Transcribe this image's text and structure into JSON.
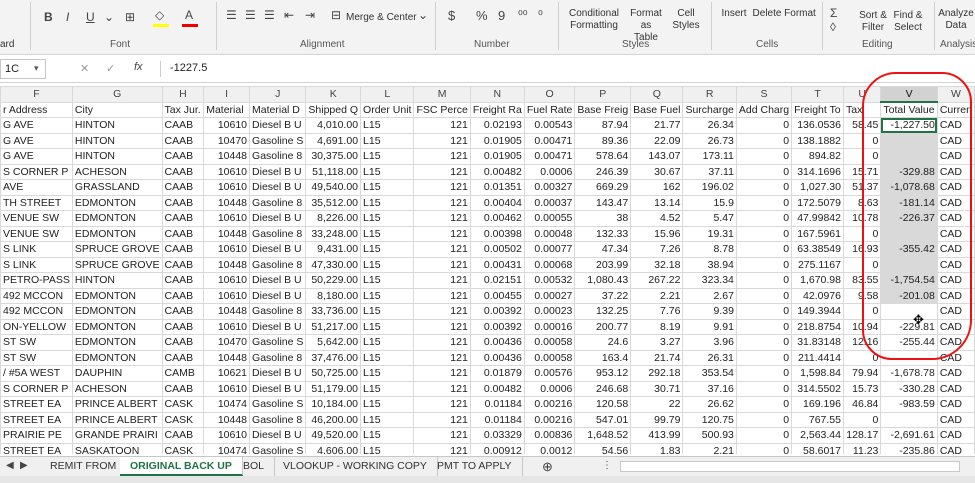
{
  "ribbon": {
    "groups": [
      "Font",
      "Alignment",
      "Number",
      "Styles",
      "Cells",
      "Editing",
      "Analysis"
    ],
    "clipboard_label": "ard",
    "merge_center": "Merge & Center",
    "cond_format": [
      "Conditional",
      "Formatting"
    ],
    "format_table": [
      "Format as",
      "Table"
    ],
    "cell_styles": [
      "Cell",
      "Styles"
    ],
    "insert": "Insert",
    "delete": "Delete",
    "format": "Format",
    "sort_filter": [
      "Sort &",
      "Filter"
    ],
    "find_select": [
      "Find &",
      "Select"
    ],
    "analyze": [
      "Analyze",
      "Data"
    ],
    "font_buttons": [
      "B",
      "I",
      "U"
    ],
    "number_buttons": [
      "$",
      "%",
      "9"
    ]
  },
  "formula_bar": {
    "name_box": "1C",
    "cancel": "✕",
    "enter": "✓",
    "fx": "fx",
    "value": "-1227.5"
  },
  "columns": [
    "F",
    "G",
    "H",
    "I",
    "J",
    "K",
    "L",
    "M",
    "N",
    "O",
    "P",
    "Q",
    "R",
    "S",
    "T",
    "U",
    "V",
    "W"
  ],
  "header_row": [
    "r Address",
    "City",
    "Tax Jur.",
    "Material",
    "Material D",
    "Shipped Q",
    "Order Unit",
    "FSC Perce",
    "Freight Ra",
    "Fuel Rate",
    "Base Freig",
    "Base Fuel",
    "Surcharge",
    "Add Charg",
    "Freight To",
    "Tax",
    "Total Value",
    "Curren"
  ],
  "rows": [
    [
      "G AVE",
      "HINTON",
      "CAAB",
      "10610",
      "Diesel B U",
      "4,010.00",
      "L15",
      "121",
      "0.02193",
      "0.00543",
      "87.94",
      "21.77",
      "26.34",
      "0",
      "136.0536",
      "58.45",
      "-1,227.50",
      "CAD"
    ],
    [
      "G AVE",
      "HINTON",
      "CAAB",
      "10470",
      "Gasoline S",
      "4,691.00",
      "L15",
      "121",
      "0.01905",
      "0.00471",
      "89.36",
      "22.09",
      "26.73",
      "0",
      "138.1882",
      "0",
      "",
      "CAD"
    ],
    [
      "G AVE",
      "HINTON",
      "CAAB",
      "10448",
      "Gasoline 8",
      "30,375.00",
      "L15",
      "121",
      "0.01905",
      "0.00471",
      "578.64",
      "143.07",
      "173.11",
      "0",
      "894.82",
      "0",
      "",
      "CAD"
    ],
    [
      "S CORNER P",
      "ACHESON",
      "CAAB",
      "10610",
      "Diesel B U",
      "51,118.00",
      "L15",
      "121",
      "0.00482",
      "0.0006",
      "246.39",
      "30.67",
      "37.11",
      "0",
      "314.1696",
      "15.71",
      "-329.88",
      "CAD"
    ],
    [
      "AVE",
      "GRASSLAND",
      "CAAB",
      "10610",
      "Diesel B U",
      "49,540.00",
      "L15",
      "121",
      "0.01351",
      "0.00327",
      "669.29",
      "162",
      "196.02",
      "0",
      "1,027.30",
      "51.37",
      "-1,078.68",
      "CAD"
    ],
    [
      "TH STREET",
      "EDMONTON",
      "CAAB",
      "10448",
      "Gasoline 8",
      "35,512.00",
      "L15",
      "121",
      "0.00404",
      "0.00037",
      "143.47",
      "13.14",
      "15.9",
      "0",
      "172.5079",
      "8.63",
      "-181.14",
      "CAD"
    ],
    [
      "VENUE SW",
      "EDMONTON",
      "CAAB",
      "10610",
      "Diesel B U",
      "8,226.00",
      "L15",
      "121",
      "0.00462",
      "0.00055",
      "38",
      "4.52",
      "5.47",
      "0",
      "47.99842",
      "10.78",
      "-226.37",
      "CAD"
    ],
    [
      "VENUE SW",
      "EDMONTON",
      "CAAB",
      "10448",
      "Gasoline 8",
      "33,248.00",
      "L15",
      "121",
      "0.00398",
      "0.00048",
      "132.33",
      "15.96",
      "19.31",
      "0",
      "167.5961",
      "0",
      "",
      "CAD"
    ],
    [
      "S LINK",
      "SPRUCE GROVE",
      "CAAB",
      "10610",
      "Diesel B U",
      "9,431.00",
      "L15",
      "121",
      "0.00502",
      "0.00077",
      "47.34",
      "7.26",
      "8.78",
      "0",
      "63.38549",
      "16.93",
      "-355.42",
      "CAD"
    ],
    [
      "S LINK",
      "SPRUCE GROVE",
      "CAAB",
      "10448",
      "Gasoline 8",
      "47,330.00",
      "L15",
      "121",
      "0.00431",
      "0.00068",
      "203.99",
      "32.18",
      "38.94",
      "0",
      "275.1167",
      "0",
      "",
      "CAD"
    ],
    [
      "PETRO-PASS",
      "HINTON",
      "CAAB",
      "10610",
      "Diesel B U",
      "50,229.00",
      "L15",
      "121",
      "0.02151",
      "0.00532",
      "1,080.43",
      "267.22",
      "323.34",
      "0",
      "1,670.98",
      "83.55",
      "-1,754.54",
      "CAD"
    ],
    [
      "492 MCCON",
      "EDMONTON",
      "CAAB",
      "10610",
      "Diesel B U",
      "8,180.00",
      "L15",
      "121",
      "0.00455",
      "0.00027",
      "37.22",
      "2.21",
      "2.67",
      "0",
      "42.0976",
      "9.58",
      "-201.08",
      "CAD"
    ],
    [
      "492 MCCON",
      "EDMONTON",
      "CAAB",
      "10448",
      "Gasoline 8",
      "33,736.00",
      "L15",
      "121",
      "0.00392",
      "0.00023",
      "132.25",
      "7.76",
      "9.39",
      "0",
      "149.3944",
      "0",
      "",
      "CAD"
    ],
    [
      "ON-YELLOW",
      "EDMONTON",
      "CAAB",
      "10610",
      "Diesel B U",
      "51,217.00",
      "L15",
      "121",
      "0.00392",
      "0.00016",
      "200.77",
      "8.19",
      "9.91",
      "0",
      "218.8754",
      "10.94",
      "-229.81",
      "CAD"
    ],
    [
      "ST SW",
      "EDMONTON",
      "CAAB",
      "10470",
      "Gasoline S",
      "5,642.00",
      "L15",
      "121",
      "0.00436",
      "0.00058",
      "24.6",
      "3.27",
      "3.96",
      "0",
      "31.83148",
      "12.16",
      "-255.44",
      "CAD"
    ],
    [
      "ST SW",
      "EDMONTON",
      "CAAB",
      "10448",
      "Gasoline 8",
      "37,476.00",
      "L15",
      "121",
      "0.00436",
      "0.00058",
      "163.4",
      "21.74",
      "26.31",
      "0",
      "211.4414",
      "0",
      "",
      "CAD"
    ],
    [
      "/ #5A WEST",
      "DAUPHIN",
      "CAMB",
      "10621",
      "Diesel B U",
      "50,725.00",
      "L15",
      "121",
      "0.01879",
      "0.00576",
      "953.12",
      "292.18",
      "353.54",
      "0",
      "1,598.84",
      "79.94",
      "-1,678.78",
      "CAD"
    ],
    [
      "S CORNER P",
      "ACHESON",
      "CAAB",
      "10610",
      "Diesel B U",
      "51,179.00",
      "L15",
      "121",
      "0.00482",
      "0.0006",
      "246.68",
      "30.71",
      "37.16",
      "0",
      "314.5502",
      "15.73",
      "-330.28",
      "CAD"
    ],
    [
      " STREET EA",
      "PRINCE ALBERT",
      "CASK",
      "10474",
      "Gasoline S",
      "10,184.00",
      "L15",
      "121",
      "0.01184",
      "0.00216",
      "120.58",
      "22",
      "26.62",
      "0",
      "169.196",
      "46.84",
      "-983.59",
      "CAD"
    ],
    [
      " STREET EA",
      "PRINCE ALBERT",
      "CASK",
      "10448",
      "Gasoline 8",
      "46,200.00",
      "L15",
      "121",
      "0.01184",
      "0.00216",
      "547.01",
      "99.79",
      "120.75",
      "0",
      "767.55",
      "0",
      "",
      "CAD"
    ],
    [
      "PRAIRIE PE",
      "GRANDE PRAIRI",
      "CAAB",
      "10610",
      "Diesel B U",
      "49,520.00",
      "L15",
      "121",
      "0.03329",
      "0.00836",
      "1,648.52",
      "413.99",
      "500.93",
      "0",
      "2,563.44",
      "128.17",
      "-2,691.61",
      "CAD"
    ],
    [
      "STREET EA",
      "SASKATOON",
      "CASK",
      "10474",
      "Gasoline S",
      "4,606.00",
      "L15",
      "121",
      "0.00912",
      "0.0012",
      "54.56",
      "1.83",
      "2.21",
      "0",
      "58.6017",
      "11.23",
      "-235.86",
      "CAD"
    ]
  ],
  "row_numbers_hidden": true,
  "tabs": [
    "REMIT FROM",
    "ORIGINAL BACK UP",
    "BOL",
    "VLOOKUP - WORKING COPY",
    "PMT TO APPLY"
  ],
  "active_tab": "ORIGINAL BACK UP",
  "add_sheet": "⊕",
  "colors": {
    "accent": "#217346",
    "annotation": "#ee1111",
    "selection": "#d9d9d9"
  }
}
